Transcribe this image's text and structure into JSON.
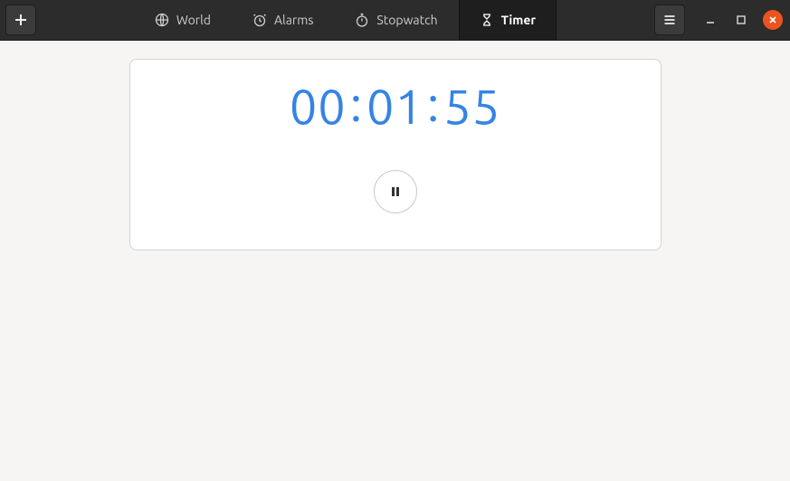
{
  "tabs": {
    "world": "World",
    "alarms": "Alarms",
    "stopwatch": "Stopwatch",
    "timer": "Timer"
  },
  "timer": {
    "hours": "00",
    "minutes": "01",
    "seconds": "55"
  }
}
